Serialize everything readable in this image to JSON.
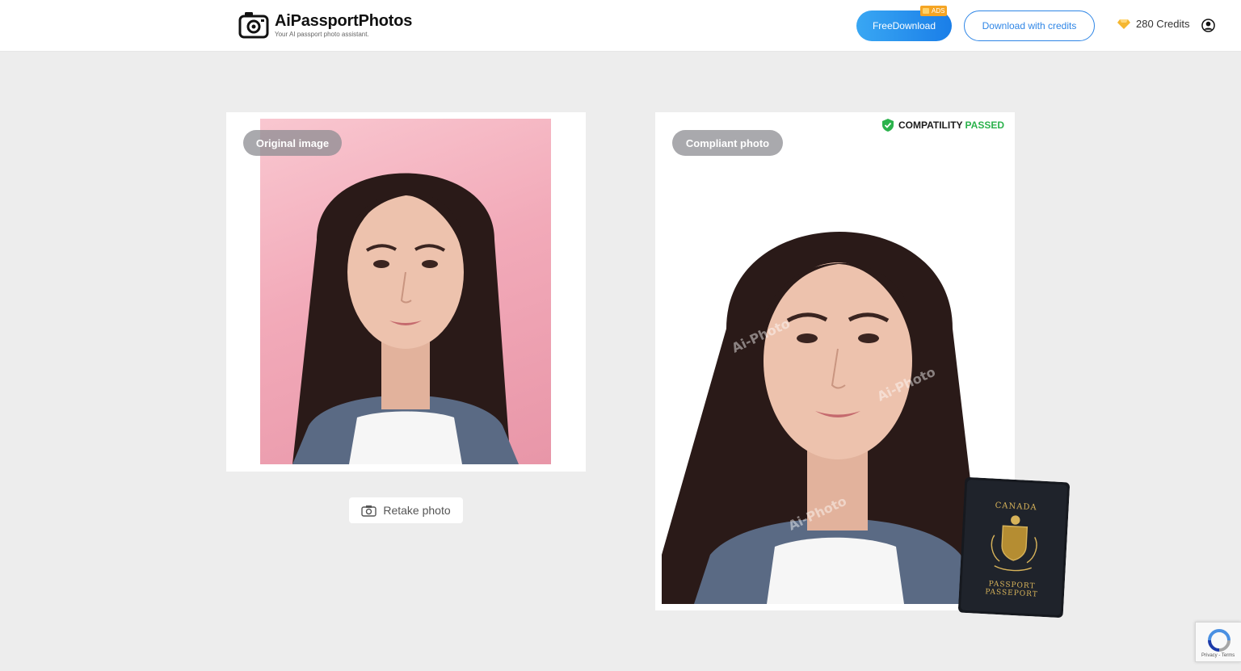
{
  "header": {
    "logo_title": "AiPassportPhotos",
    "logo_subtitle": "Your AI passport photo assistant.",
    "free_download_label": "FreeDownload",
    "ads_label": "ADS",
    "download_credits_label": "Download with credits",
    "credits_text": "280 Credits"
  },
  "left_panel": {
    "label": "Original image",
    "retake_label": "Retake photo"
  },
  "right_panel": {
    "label": "Compliant photo",
    "compat_prefix": "COMPATILITY",
    "compat_status": "PASSED",
    "watermark": "Ai-Photo"
  },
  "passport": {
    "country": "CANADA",
    "line1": "PASSPORT",
    "line2": "PASSEPORT"
  },
  "recaptcha": {
    "text": "Privacy - Terms"
  },
  "colors": {
    "primary_blue": "#1a7ee8",
    "passed_green": "#2bb24c",
    "ads_orange": "#f5a524",
    "credits_gold": "#f5b731"
  }
}
